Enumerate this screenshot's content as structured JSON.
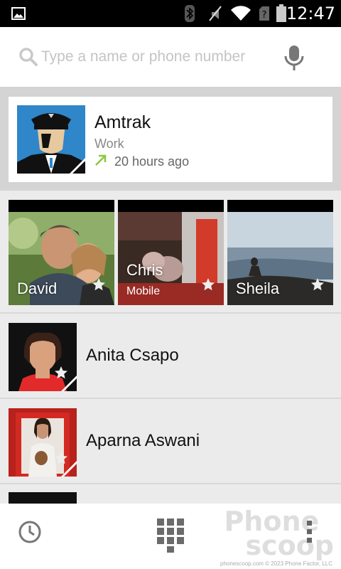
{
  "status_bar": {
    "time": "12:47",
    "icons": [
      "image-icon",
      "bluetooth-icon",
      "mute-icon",
      "wifi-icon",
      "no-sim-icon",
      "battery-icon"
    ]
  },
  "search": {
    "placeholder": "Type a name or phone number",
    "value": ""
  },
  "recent_call": {
    "name": "Amtrak",
    "type": "Work",
    "time": "20 hours ago",
    "direction": "outgoing-arrow-icon"
  },
  "favorites": [
    {
      "name": "David",
      "sub": ""
    },
    {
      "name": "Chris",
      "sub": "Mobile"
    },
    {
      "name": "Sheila",
      "sub": ""
    }
  ],
  "contacts": [
    {
      "name": "Anita Csapo"
    },
    {
      "name": "Aparna Aswani"
    }
  ],
  "bottom_nav": {
    "icons": [
      "history-icon",
      "dialpad-icon",
      "overflow-menu-icon"
    ],
    "watermark_line1": "Phone",
    "watermark_line2": "scoop",
    "copyright": "phonescoop.com  © 2023 Phone Factor, LLC"
  },
  "colors": {
    "accent_green": "#8cc63f",
    "background": "#ebebeb",
    "card": "#ffffff"
  }
}
